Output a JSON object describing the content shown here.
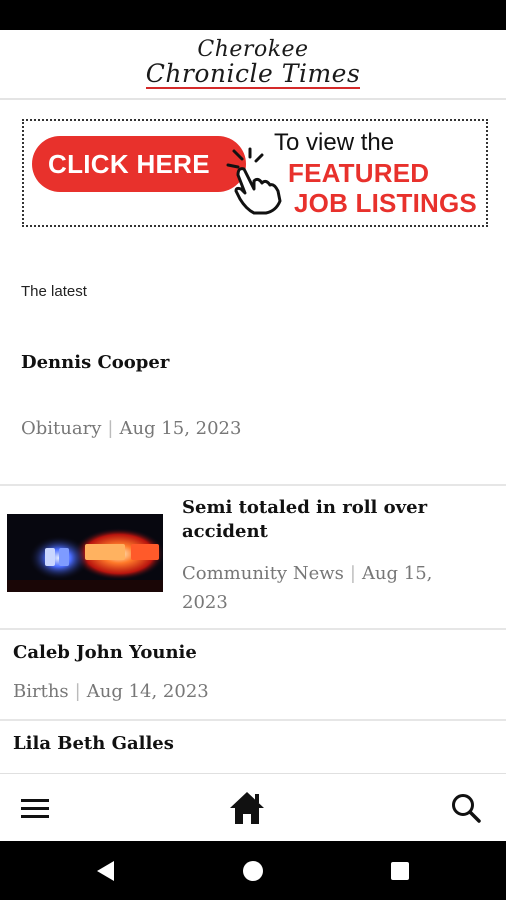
{
  "header": {
    "logo_line1": "Cherokee",
    "logo_line2": "Chronicle Times"
  },
  "banner": {
    "click_label": "CLICK HERE",
    "text_line1": "To view the",
    "text_line2": "FEATURED",
    "text_line3": "JOB LISTINGS",
    "accent_color": "#e8312c"
  },
  "section": {
    "label": "The latest"
  },
  "lead_story": {
    "title": "Dennis Cooper",
    "category": "Obituary",
    "separator": "|",
    "date": "Aug 15, 2023"
  },
  "stories": [
    {
      "title": "Semi totaled in roll over accident",
      "category": "Community News",
      "separator": "|",
      "date": "Aug 15, 2023",
      "thumbnail": "police-lights-image"
    },
    {
      "title": "Caleb John Younie",
      "category": "Births",
      "separator": "|",
      "date": "Aug 14, 2023"
    },
    {
      "title": "Lila Beth Galles"
    }
  ],
  "bottom_nav": {
    "items": [
      "menu-icon",
      "home-icon",
      "search-icon"
    ]
  },
  "system_nav": {
    "items": [
      "back-icon",
      "home-circle-icon",
      "recents-icon"
    ]
  }
}
